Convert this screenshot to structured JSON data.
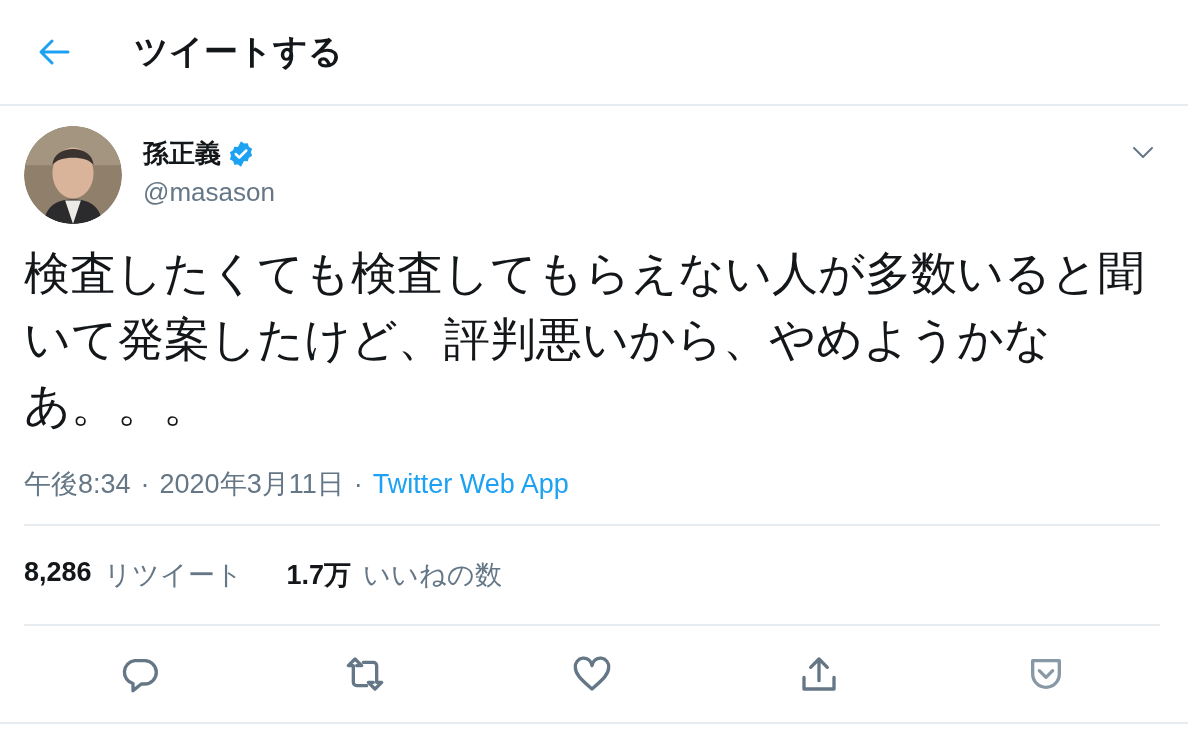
{
  "header": {
    "title": "ツイートする"
  },
  "tweet": {
    "author": {
      "name": "孫正義",
      "verified": true,
      "handle": "@masason"
    },
    "text": "検査したくても検査してもらえない人が多数いると聞いて発案したけど、評判悪いから、やめようかなあ。。。",
    "time": "午後8:34",
    "separator": "·",
    "date": "2020年3月11日",
    "source": "Twitter Web App",
    "stats": [
      {
        "count": "8,286",
        "label": "リツイート"
      },
      {
        "count": "1.7万",
        "label": "いいねの数"
      }
    ],
    "actions": [
      {
        "kind": "reply"
      },
      {
        "kind": "retweet"
      },
      {
        "kind": "like"
      },
      {
        "kind": "share"
      },
      {
        "kind": "pocket"
      }
    ]
  }
}
